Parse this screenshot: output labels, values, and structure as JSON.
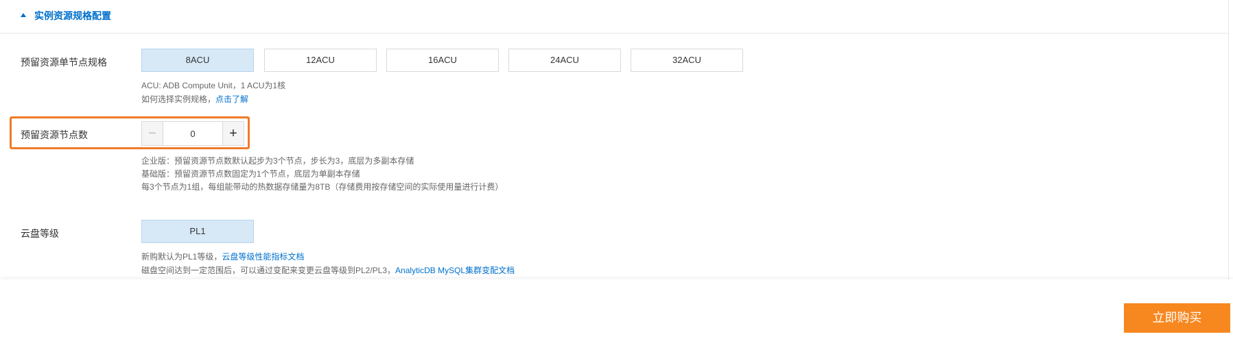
{
  "section": {
    "title": "实例资源规格配置"
  },
  "node_spec": {
    "label": "预留资源单节点规格",
    "options": [
      "8ACU",
      "12ACU",
      "16ACU",
      "24ACU",
      "32ACU"
    ],
    "selected": "8ACU",
    "hint_line1": "ACU: ADB Compute Unit，1 ACU为1核",
    "hint_line2_prefix": "如何选择实例规格，",
    "hint_line2_link": "点击了解"
  },
  "node_count": {
    "label": "预留资源节点数",
    "value": "0",
    "hint_line1": "企业版：预留资源节点数默认起步为3个节点，步长为3，底层为多副本存储",
    "hint_line2": "基础版：预留资源节点数固定为1个节点，底层为单副本存储",
    "hint_line3": "每3个节点为1组，每组能带动的热数据存储量为8TB（存储费用按存储空间的实际使用量进行计费）"
  },
  "disk_level": {
    "label": "云盘等级",
    "options": [
      "PL1"
    ],
    "selected": "PL1",
    "hint_line1_prefix": "新购默认为PL1等级，",
    "hint_line1_link": "云盘等级性能指标文档",
    "hint_line2_prefix": "磁盘空间达到一定范围后，可以通过变配来变更云盘等级到PL2/PL3，",
    "hint_line2_link": "AnalyticDB MySQL集群变配文档"
  },
  "footer": {
    "buy_label": "立即购买"
  },
  "colors": {
    "accent": "#0070cc",
    "buy": "#f7871f",
    "highlight": "#f07a28",
    "selected_bg": "#d7e8f7"
  }
}
